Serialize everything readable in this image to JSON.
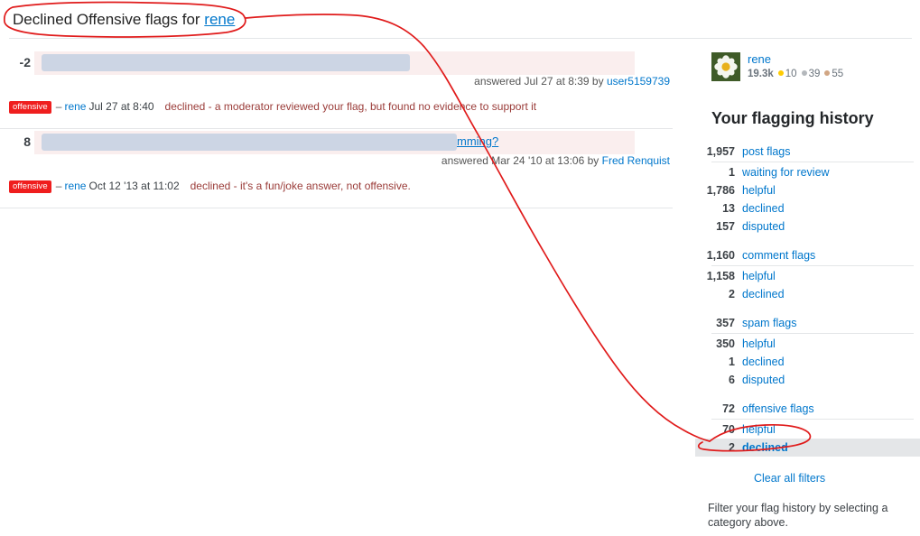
{
  "page": {
    "title_prefix": "Declined Offensive flags for ",
    "title_user": "rene"
  },
  "flag_entries": [
    {
      "score": "-2",
      "post_title_visible": "",
      "meta_prefix": "answered Jul 27 at 8:39 by ",
      "meta_author": "user5159739",
      "badge": "offensive",
      "dash": "–",
      "flagger": "rene",
      "flag_date": "Jul 27 at 8:40",
      "reason": "declined - a moderator reviewed your flag, but found no evidence to support it"
    },
    {
      "score": "8",
      "post_title_visible": "mming?",
      "meta_prefix": "answered Mar 24 '10 at 13:06 by ",
      "meta_author": "Fred Renquist",
      "badge": "offensive",
      "dash": "–",
      "flagger": "rene",
      "flag_date": "Oct 12 '13 at 11:02",
      "reason": "declined - it's a fun/joke answer, not offensive."
    }
  ],
  "sidebar": {
    "user": {
      "name": "rene",
      "reputation": "19.3k",
      "gold": "10",
      "silver": "39",
      "bronze": "55"
    },
    "heading": "Your flagging history",
    "stat_groups": [
      {
        "header": {
          "count": "1,957",
          "label": "post flags"
        },
        "rows": [
          {
            "count": "1",
            "label": "waiting for review",
            "highlight": false
          },
          {
            "count": "1,786",
            "label": "helpful",
            "highlight": false
          },
          {
            "count": "13",
            "label": "declined",
            "highlight": false
          },
          {
            "count": "157",
            "label": "disputed",
            "highlight": false
          }
        ]
      },
      {
        "header": {
          "count": "1,160",
          "label": "comment flags"
        },
        "rows": [
          {
            "count": "1,158",
            "label": "helpful",
            "highlight": false
          },
          {
            "count": "2",
            "label": "declined",
            "highlight": false
          }
        ]
      },
      {
        "header": {
          "count": "357",
          "label": "spam flags"
        },
        "rows": [
          {
            "count": "350",
            "label": "helpful",
            "highlight": false
          },
          {
            "count": "1",
            "label": "declined",
            "highlight": false
          },
          {
            "count": "6",
            "label": "disputed",
            "highlight": false
          }
        ]
      },
      {
        "header": {
          "count": "72",
          "label": "offensive flags"
        },
        "rows": [
          {
            "count": "70",
            "label": "helpful",
            "highlight": false
          },
          {
            "count": "2",
            "label": "declined",
            "highlight": true
          }
        ]
      }
    ],
    "clear_filters": "Clear all filters",
    "filter_help": "Filter your flag history by selecting a category above."
  },
  "colors": {
    "link": "#0077cc",
    "flag_badge_bg": "#ef1e1e",
    "reason_text": "#9a3b38",
    "post_row_bg": "#faeeee",
    "redaction": "#ccd5e4",
    "highlight_row": "#e4e6e8",
    "annotation": "#e01b1b"
  }
}
